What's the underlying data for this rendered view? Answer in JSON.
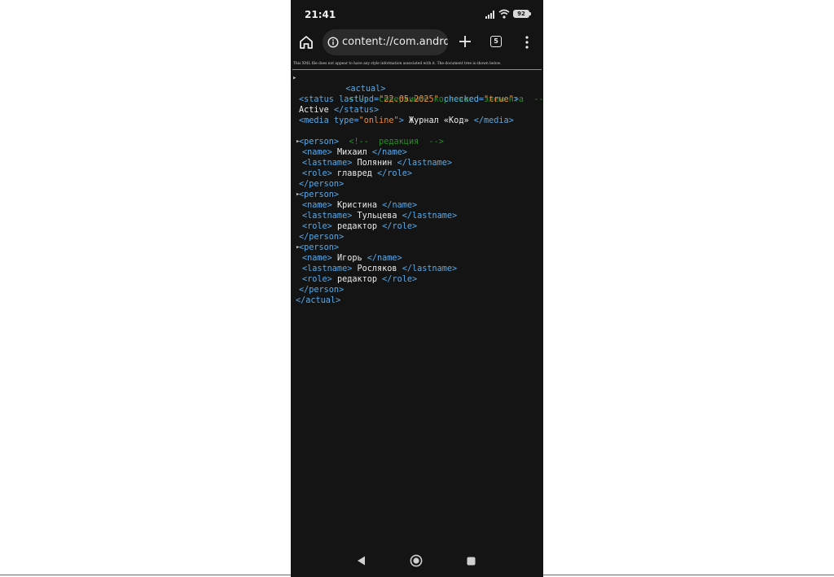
{
  "status_bar": {
    "time": "21:41",
    "battery": "92",
    "icons": [
      "signal-icon",
      "wifi-icon",
      "battery-icon"
    ]
  },
  "browser": {
    "url": "content://com.android",
    "tab_count": "5",
    "icons": [
      "home-icon",
      "info-icon",
      "plus-icon",
      "tab-switcher-icon",
      "more-vert-icon"
    ]
  },
  "xml_viewer": {
    "notice": "This XML file does not appear to have any style information associated with it. The document tree is shown below.",
    "root_open": "<actual>",
    "root_comment": "<!--  содержимое корневого элемента  -->",
    "status": {
      "open_tag": "<status",
      "attr1_name": "lastUpd=",
      "attr1_value": "\"22.05.2025\"",
      "attr2_name": "checked=",
      "attr2_value": "\"true\"",
      "open_close": ">",
      "text": "Active",
      "close_tag": "</status>"
    },
    "media": {
      "open_tag": "<media",
      "attr_name": "type=",
      "attr_value": "\"online\"",
      "open_close": ">",
      "text": "Журнал «Код»",
      "close_tag": "</media>"
    },
    "editors_comment": "<!--  редакция  -->",
    "persons": [
      {
        "open": "<person>",
        "name_open": "<name>",
        "name": "Михаил",
        "name_close": "</name>",
        "lastname_open": "<lastname>",
        "lastname": "Полянин",
        "lastname_close": "</lastname>",
        "role_open": "<role>",
        "role": "главред",
        "role_close": "</role>",
        "close": "</person>"
      },
      {
        "open": "<person>",
        "name_open": "<name>",
        "name": "Кристина",
        "name_close": "</name>",
        "lastname_open": "<lastname>",
        "lastname": "Тульцева",
        "lastname_close": "</lastname>",
        "role_open": "<role>",
        "role": "редактор",
        "role_close": "</role>",
        "close": "</person>"
      },
      {
        "open": "<person>",
        "name_open": "<name>",
        "name": "Игорь",
        "name_close": "</name>",
        "lastname_open": "<lastname>",
        "lastname": "Росляков",
        "lastname_close": "</lastname>",
        "role_open": "<role>",
        "role": "редактор",
        "role_close": "</role>",
        "close": "</person>"
      }
    ],
    "root_close": "</actual>"
  },
  "colors": {
    "tag": "#5aa9e6",
    "attribute_value": "#e8893a",
    "comment": "#2f8a2f",
    "text": "#ececec",
    "background": "#141414"
  },
  "nav_bar": {
    "icons": [
      "back-icon",
      "home-nav-icon",
      "recents-icon"
    ]
  }
}
